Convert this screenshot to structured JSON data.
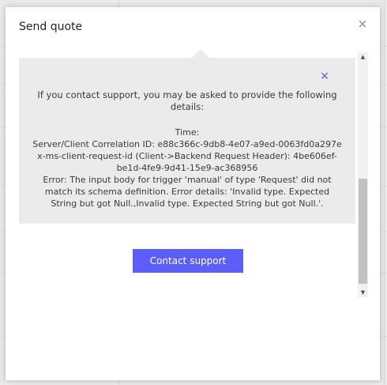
{
  "dialog": {
    "title": "Send quote",
    "close_icon": "×"
  },
  "error_panel": {
    "close_icon": "✕",
    "intro": "If you contact support, you may be asked to provide the following details:",
    "time_label": "Time:",
    "correlation_id": "Server/Client Correlation ID: e88c366c-9db8-4e07-a9ed-0063fd0a297e",
    "request_id": "x-ms-client-request-id (Client->Backend Request Header): 4be606ef-be1d-4fe9-9d41-15e9-ac368956",
    "error_message": "Error: The input body for trigger 'manual' of type 'Request' did not match its schema definition. Error details: 'Invalid type. Expected String but got Null.,Invalid type. Expected String but got Null.'."
  },
  "contact_button": {
    "label": "Contact support"
  },
  "scrollbar": {
    "up_icon": "▲",
    "down_icon": "▼"
  },
  "colors": {
    "accent": "#5b5ff7",
    "panel_background": "#ebebeb",
    "close_accent": "#5b6ad9"
  }
}
